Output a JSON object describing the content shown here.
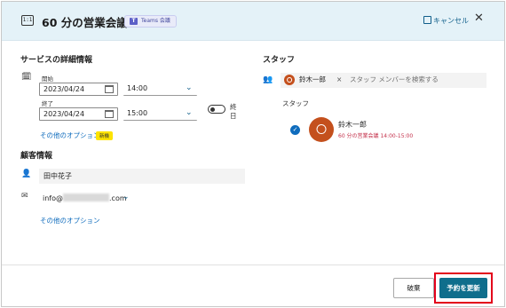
{
  "header": {
    "icon_text": "1:1",
    "title": "60 分の営業会議",
    "teams_badge": "Teams 会議",
    "cancel_label": "キャンセル",
    "close_symbol": "✕"
  },
  "service": {
    "title": "サービスの詳細情報",
    "start_label": "開始",
    "start_date": "2023/04/24",
    "start_time": "14:00",
    "end_label": "終了",
    "end_date": "2023/04/24",
    "end_time": "15:00",
    "all_day_label": "終日",
    "more_options": "その他のオプション",
    "new_badge": "新機",
    "all_day_on": false
  },
  "customer": {
    "title": "顧客情報",
    "name": "田中花子",
    "email_prefix": "info@",
    "email_suffix": ".com",
    "more_options": "その他のオプション"
  },
  "staff": {
    "title": "スタッフ",
    "chip_name": "鈴木一郎",
    "search_placeholder": "スタッフ メンバーを検索する",
    "list_label": "スタッフ",
    "member_name": "鈴木一郎",
    "member_meeting": "60 分の営業会議 14:00-15:00"
  },
  "footer": {
    "discard_label": "破棄",
    "update_label": "予約を更新"
  },
  "colors": {
    "accent": "#0f6e8c",
    "avatar": "#c4501d",
    "highlight": "#e3001b",
    "header_bg": "#e4f2f8"
  }
}
